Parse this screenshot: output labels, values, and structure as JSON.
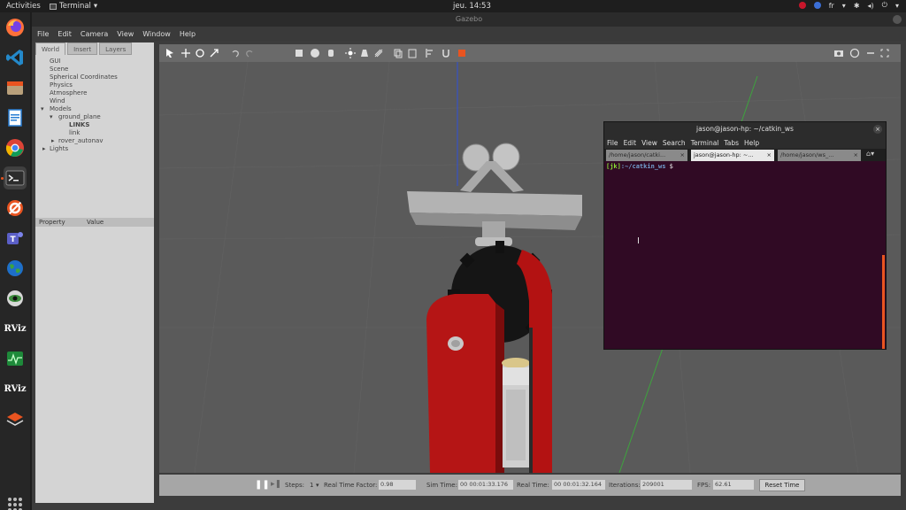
{
  "topbar": {
    "activities": "Activities",
    "app_name": "Terminal",
    "clock": "jeu. 14:53",
    "lang": "fr"
  },
  "dock": {
    "items": [
      "firefox-icon",
      "vscode-icon",
      "files-icon",
      "writer-icon",
      "chrome-icon",
      "terminal-icon",
      "settings-icon",
      "teams-icon",
      "globe-icon",
      "eye-icon",
      "rviz-icon",
      "system-monitor-icon",
      "rviz-icon",
      "stack-icon"
    ],
    "rviz_label": "RViz"
  },
  "gazebo": {
    "title": "Gazebo",
    "menu": [
      "File",
      "Edit",
      "Camera",
      "View",
      "Window",
      "Help"
    ],
    "tabs": [
      "World",
      "Insert",
      "Layers"
    ],
    "tree": {
      "gui": "GUI",
      "scene": "Scene",
      "spherical": "Spherical Coordinates",
      "physics": "Physics",
      "atmosphere": "Atmosphere",
      "wind": "Wind",
      "models": "Models",
      "ground_plane": "ground_plane",
      "links": "LINKS",
      "link": "link",
      "rover": "rover_autonav",
      "lights": "Lights"
    },
    "props": {
      "property": "Property",
      "value": "Value"
    },
    "bottom": {
      "steps_label": "Steps:",
      "steps_value": "1",
      "rtf_label": "Real Time Factor:",
      "rtf_value": "0.98",
      "sim_label": "Sim Time:",
      "sim_value": "00 00:01:33.176",
      "real_label": "Real Time:",
      "real_value": "00 00:01:32.164",
      "iter_label": "Iterations:",
      "iter_value": "209001",
      "fps_label": "FPS:",
      "fps_value": "62.61",
      "reset": "Reset Time"
    }
  },
  "terminal": {
    "title": "jason@jason-hp: ~/catkin_ws",
    "menu": [
      "File",
      "Edit",
      "View",
      "Search",
      "Terminal",
      "Tabs",
      "Help"
    ],
    "tabs": [
      "/home/jason/catki...",
      "jason@jason-hp: ~...",
      "/home/jason/ws_..."
    ],
    "prompt_user": "[jk]",
    "prompt_path": ":~/catkin_ws",
    "prompt_sym": " $"
  }
}
